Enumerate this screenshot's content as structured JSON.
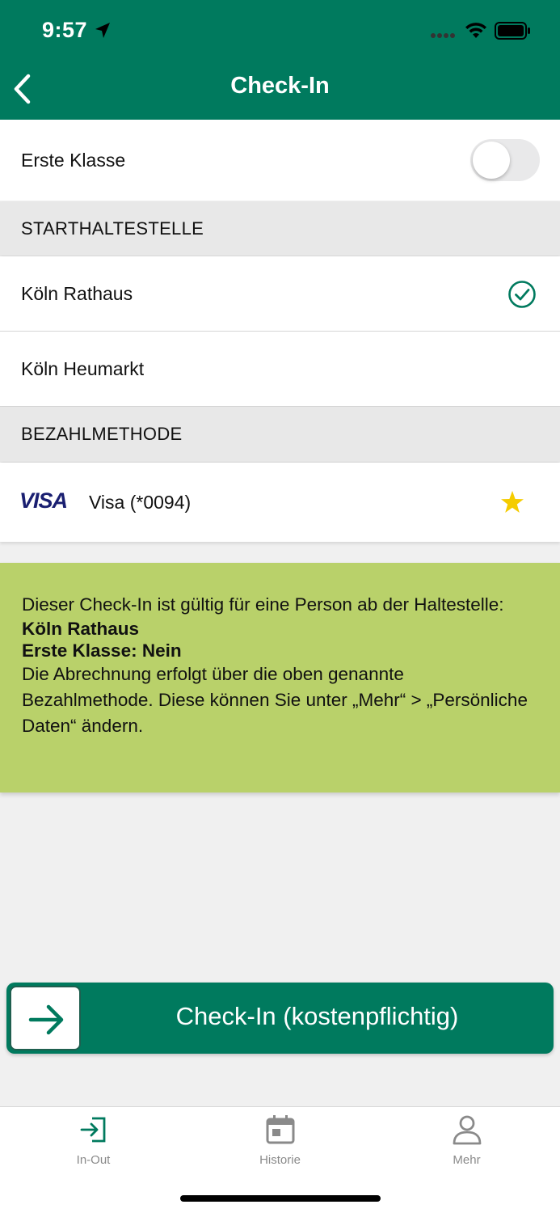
{
  "status_bar": {
    "time": "9:57"
  },
  "header": {
    "title": "Check-In"
  },
  "first_class": {
    "label": "Erste Klasse",
    "enabled": false
  },
  "start_section": {
    "heading": "STARTHALTESTELLE",
    "stops": [
      {
        "label": "Köln Rathaus",
        "selected": true
      },
      {
        "label": "Köln Heumarkt",
        "selected": false
      }
    ]
  },
  "payment_section": {
    "heading": "BEZAHLMETHODE",
    "method": {
      "brand": "VISA",
      "label": "Visa (*0094)",
      "favorite": true
    }
  },
  "info": {
    "line1": "Dieser Check-In ist gültig für eine Person ab der Haltestelle:",
    "stop_bold": "Köln Rathaus",
    "class_bold": "Erste Klasse:  Nein",
    "line2": "Die Abrechnung erfolgt über die oben genannte Bezahlmethode. Diese können Sie unter „Mehr“ > „Persönliche Daten“ ändern."
  },
  "cta": {
    "label": "Check-In (kostenpflichtig)"
  },
  "tabbar": {
    "tabs": [
      {
        "label": "In-Out",
        "icon": "sign-in-icon"
      },
      {
        "label": "Historie",
        "icon": "calendar-icon"
      },
      {
        "label": "Mehr",
        "icon": "person-icon"
      }
    ]
  },
  "colors": {
    "brand_green": "#007a5e",
    "info_green": "#b9d16a",
    "star_yellow": "#f5cc00",
    "tab_inactive": "#8a8a8a"
  }
}
